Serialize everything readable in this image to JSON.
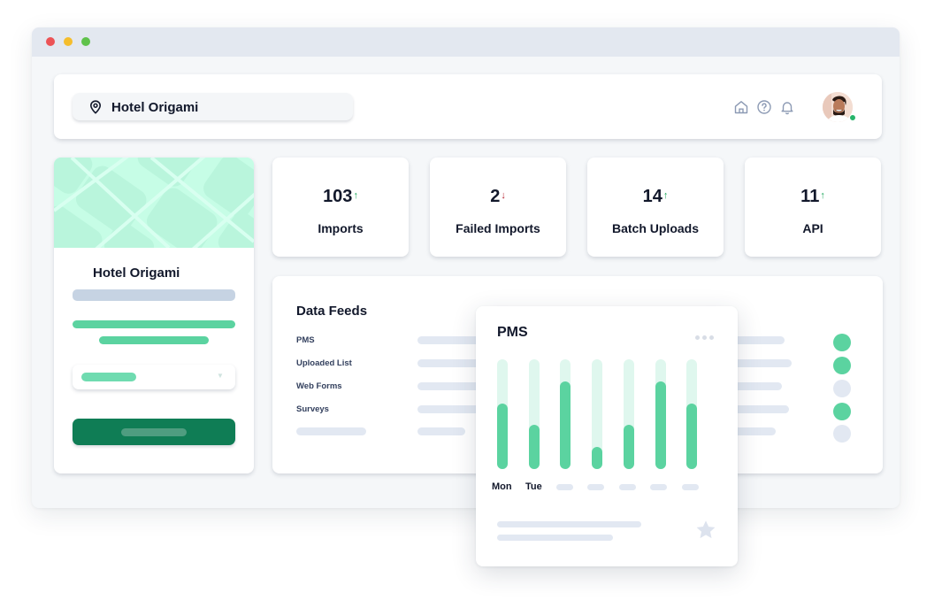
{
  "window": {
    "traffic_lights": [
      "close",
      "minimize",
      "zoom"
    ]
  },
  "topbar": {
    "location": "Hotel Origami",
    "location_icon": "map-pin-icon",
    "icons": [
      "home-icon",
      "help-icon",
      "bell-icon"
    ],
    "user_status": "online"
  },
  "profile": {
    "name": "Hotel Origami"
  },
  "stats": [
    {
      "value": "103",
      "trend": "up",
      "trend_glyph": "↑",
      "label": "Imports"
    },
    {
      "value": "2",
      "trend": "down",
      "trend_glyph": "↓",
      "label": "Failed Imports"
    },
    {
      "value": "14",
      "trend": "up",
      "trend_glyph": "↑",
      "label": "Batch Uploads"
    },
    {
      "value": "11",
      "trend": "up",
      "trend_glyph": "↑",
      "label": "API"
    }
  ],
  "feeds": {
    "title": "Data Feeds",
    "items": [
      {
        "label": "PMS",
        "status": "active"
      },
      {
        "label": "Uploaded List",
        "status": "active"
      },
      {
        "label": "Web Forms",
        "status": "inactive"
      },
      {
        "label": "Surveys",
        "status": "active"
      },
      {
        "label": "",
        "status": "inactive"
      }
    ]
  },
  "pms": {
    "title": "PMS",
    "days": [
      "Mon",
      "Tue",
      "",
      "",
      "",
      "",
      ""
    ],
    "levels": [
      0.6,
      0.4,
      0.8,
      0.2,
      0.4,
      0.8,
      0.6
    ]
  },
  "colors": {
    "accent": "#5bd3a0",
    "primary_button": "#0f7d55",
    "trend_up": "#1ea85c",
    "trend_down": "#b5202e",
    "inactive": "#e2e8f2"
  }
}
